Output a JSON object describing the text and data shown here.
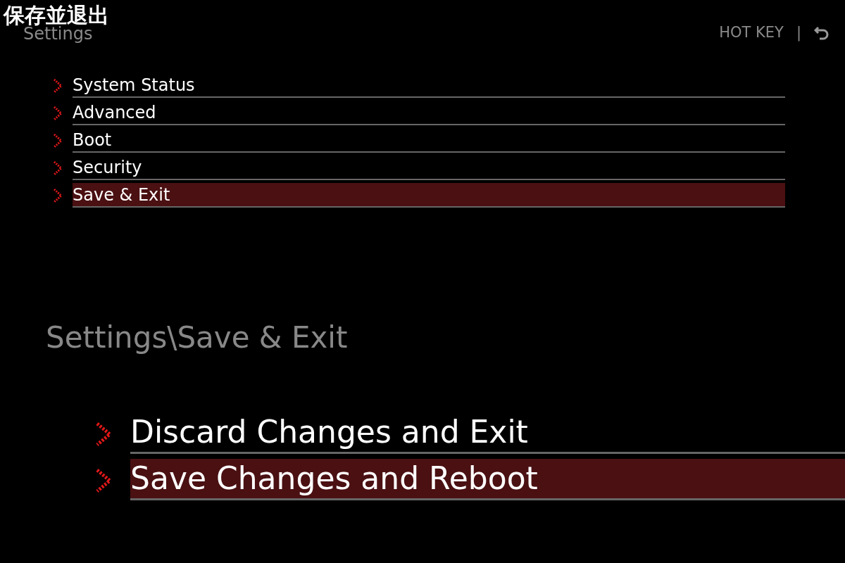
{
  "caption": "保存並退出",
  "header": {
    "title": "Settings",
    "hotkey": "HOT KEY",
    "separator": "|"
  },
  "menu": [
    {
      "label": "System Status",
      "selected": false
    },
    {
      "label": "Advanced",
      "selected": false
    },
    {
      "label": "Boot",
      "selected": false
    },
    {
      "label": "Security",
      "selected": false
    },
    {
      "label": "Save & Exit",
      "selected": true
    }
  ],
  "breadcrumb": "Settings\\Save & Exit",
  "options": [
    {
      "label": "Discard Changes and Exit",
      "selected": false
    },
    {
      "label": "Save Changes and Reboot",
      "selected": true
    }
  ]
}
